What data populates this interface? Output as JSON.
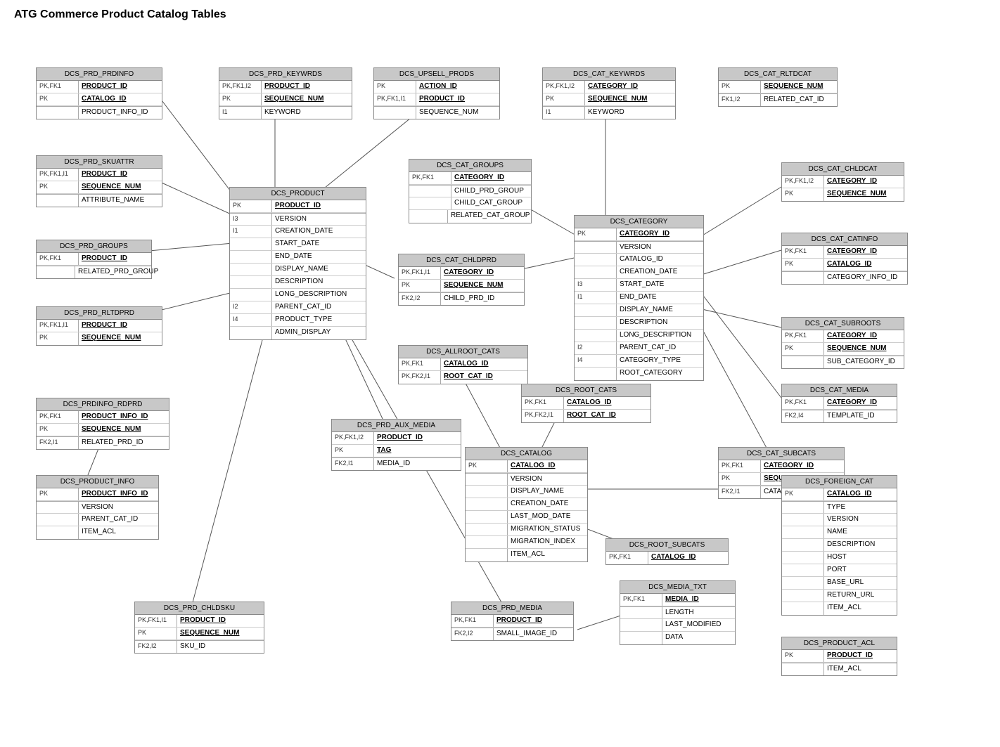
{
  "title": "ATG Commerce Product Catalog Tables",
  "tables": {
    "dcs_prd_prdinfo": {
      "name": "DCS_PRD_PRDINFO",
      "rows": [
        {
          "key": "PK,FK1",
          "field": "PRODUCT_ID",
          "pk": true
        },
        {
          "key": "PK",
          "field": "CATALOG_ID",
          "pk": true
        },
        {
          "key": "",
          "field": "PRODUCT_INFO_ID",
          "pk": false
        }
      ]
    },
    "dcs_prd_keywrds": {
      "name": "DCS_PRD_KEYWRDS",
      "rows": [
        {
          "key": "PK,FK1,I2",
          "field": "PRODUCT_ID",
          "pk": true
        },
        {
          "key": "PK",
          "field": "SEQUENCE_NUM",
          "pk": true
        },
        {
          "key": "I1",
          "field": "KEYWORD",
          "pk": false
        }
      ]
    },
    "dcs_upsell_prods": {
      "name": "DCS_UPSELL_PRODS",
      "rows": [
        {
          "key": "PK",
          "field": "ACTION_ID",
          "pk": true
        },
        {
          "key": "PK,FK1,I1",
          "field": "PRODUCT_ID",
          "pk": true
        },
        {
          "key": "",
          "field": "SEQUENCE_NUM",
          "pk": false
        }
      ]
    },
    "dcs_cat_keywrds": {
      "name": "DCS_CAT_KEYWRDS",
      "rows": [
        {
          "key": "PK,FK1,I2",
          "field": "CATEGORY_ID",
          "pk": true
        },
        {
          "key": "PK",
          "field": "SEQUENCE_NUM",
          "pk": true
        },
        {
          "key": "I1",
          "field": "KEYWORD",
          "pk": false
        }
      ]
    },
    "dcs_cat_rltdcat": {
      "name": "DCS_CAT_RLTDCAT",
      "rows": [
        {
          "key": "PK",
          "field": "SEQUENCE_NUM",
          "pk": true
        },
        {
          "key": "FK1,I2",
          "field": "RELATED_CAT_ID",
          "pk": false
        }
      ]
    },
    "dcs_prd_skuattr": {
      "name": "DCS_PRD_SKUATTR",
      "rows": [
        {
          "key": "PK,FK1,I1",
          "field": "PRODUCT_ID",
          "pk": true
        },
        {
          "key": "PK",
          "field": "SEQUENCE_NUM",
          "pk": true
        },
        {
          "key": "",
          "field": "ATTRIBUTE_NAME",
          "pk": false
        }
      ]
    },
    "dcs_product": {
      "name": "DCS_PRODUCT",
      "rows": [
        {
          "key": "PK",
          "field": "PRODUCT_ID",
          "pk": true
        },
        {
          "key": "I3",
          "field": "VERSION",
          "pk": false
        },
        {
          "key": "I1",
          "field": "CREATION_DATE",
          "pk": false
        },
        {
          "key": "",
          "field": "START_DATE",
          "pk": false
        },
        {
          "key": "",
          "field": "END_DATE",
          "pk": false
        },
        {
          "key": "",
          "field": "DISPLAY_NAME",
          "pk": false
        },
        {
          "key": "",
          "field": "DESCRIPTION",
          "pk": false
        },
        {
          "key": "",
          "field": "LONG_DESCRIPTION",
          "pk": false
        },
        {
          "key": "I2",
          "field": "PARENT_CAT_ID",
          "pk": false
        },
        {
          "key": "I4",
          "field": "PRODUCT_TYPE",
          "pk": false
        },
        {
          "key": "",
          "field": "ADMIN_DISPLAY",
          "pk": false
        }
      ]
    },
    "dcs_cat_groups": {
      "name": "DCS_CAT_GROUPS",
      "rows": [
        {
          "key": "PK,FK1",
          "field": "CATEGORY_ID",
          "pk": true
        },
        {
          "key": "",
          "field": "CHILD_PRD_GROUP",
          "pk": false
        },
        {
          "key": "",
          "field": "CHILD_CAT_GROUP",
          "pk": false
        },
        {
          "key": "",
          "field": "RELATED_CAT_GROUP",
          "pk": false
        }
      ]
    },
    "dcs_prd_groups": {
      "name": "DCS_PRD_GROUPS",
      "rows": [
        {
          "key": "PK,FK1",
          "field": "PRODUCT_ID",
          "pk": true
        },
        {
          "key": "",
          "field": "RELATED_PRD_GROUP",
          "pk": false
        }
      ]
    },
    "dcs_prd_rltdprd": {
      "name": "DCS_PRD_RLTDPRD",
      "rows": [
        {
          "key": "PK,FK1,I1",
          "field": "PRODUCT_ID",
          "pk": true
        },
        {
          "key": "PK",
          "field": "SEQUENCE_NUM",
          "pk": true
        }
      ]
    },
    "dcs_category": {
      "name": "DCS_CATEGORY",
      "rows": [
        {
          "key": "PK",
          "field": "CATEGORY_ID",
          "pk": true
        },
        {
          "key": "",
          "field": "VERSION",
          "pk": false
        },
        {
          "key": "",
          "field": "CATALOG_ID",
          "pk": false
        },
        {
          "key": "",
          "field": "CREATION_DATE",
          "pk": false
        },
        {
          "key": "I3",
          "field": "START_DATE",
          "pk": false
        },
        {
          "key": "I1",
          "field": "END_DATE",
          "pk": false
        },
        {
          "key": "",
          "field": "DISPLAY_NAME",
          "pk": false
        },
        {
          "key": "",
          "field": "DESCRIPTION",
          "pk": false
        },
        {
          "key": "",
          "field": "LONG_DESCRIPTION",
          "pk": false
        },
        {
          "key": "I2",
          "field": "PARENT_CAT_ID",
          "pk": false
        },
        {
          "key": "I4",
          "field": "CATEGORY_TYPE",
          "pk": false
        },
        {
          "key": "",
          "field": "ROOT_CATEGORY",
          "pk": false
        }
      ]
    },
    "dcs_cat_chldprd": {
      "name": "DCS_CAT_CHLDPRD",
      "rows": [
        {
          "key": "PK,FK1,I1",
          "field": "CATEGORY_ID",
          "pk": true
        },
        {
          "key": "PK",
          "field": "SEQUENCE_NUM",
          "pk": true
        },
        {
          "key": "FK2,I2",
          "field": "CHILD_PRD_ID",
          "pk": false
        }
      ]
    },
    "dcs_cat_chldcat": {
      "name": "DCS_CAT_CHLDCAT",
      "rows": [
        {
          "key": "PK,FK1,I2",
          "field": "CATEGORY_ID",
          "pk": true
        },
        {
          "key": "PK",
          "field": "SEQUENCE_NUM",
          "pk": true
        }
      ]
    },
    "dcs_cat_catinfo": {
      "name": "DCS_CAT_CATINFO",
      "rows": [
        {
          "key": "PK,FK1",
          "field": "CATEGORY_ID",
          "pk": true
        },
        {
          "key": "PK",
          "field": "CATALOG_ID",
          "pk": true
        },
        {
          "key": "",
          "field": "CATEGORY_INFO_ID",
          "pk": false
        }
      ]
    },
    "dcs_allroot_cats": {
      "name": "DCS_ALLROOT_CATS",
      "rows": [
        {
          "key": "PK,FK1",
          "field": "CATALOG_ID",
          "pk": true
        },
        {
          "key": "PK,FK2,I1",
          "field": "ROOT_CAT_ID",
          "pk": true
        }
      ]
    },
    "dcs_cat_subroots": {
      "name": "DCS_CAT_SUBROOTS",
      "rows": [
        {
          "key": "PK,FK1",
          "field": "CATEGORY_ID",
          "pk": true
        },
        {
          "key": "PK",
          "field": "SEQUENCE_NUM",
          "pk": true
        },
        {
          "key": "",
          "field": "SUB_CATEGORY_ID",
          "pk": false
        }
      ]
    },
    "dcs_root_cats": {
      "name": "DCS_ROOT_CATS",
      "rows": [
        {
          "key": "PK,FK1",
          "field": "CATALOG_ID",
          "pk": true
        },
        {
          "key": "PK,FK2,I1",
          "field": "ROOT_CAT_ID",
          "pk": true
        }
      ]
    },
    "dcs_prdinfo_rdprd": {
      "name": "DCS_PRDINFO_RDPRD",
      "rows": [
        {
          "key": "PK,FK1",
          "field": "PRODUCT_INFO_ID",
          "pk": true
        },
        {
          "key": "PK",
          "field": "SEQUENCE_NUM",
          "pk": true
        },
        {
          "key": "FK2,I1",
          "field": "RELATED_PRD_ID",
          "pk": false
        }
      ]
    },
    "dcs_product_info": {
      "name": "DCS_PRODUCT_INFO",
      "rows": [
        {
          "key": "PK",
          "field": "PRODUCT_INFO_ID",
          "pk": true
        },
        {
          "key": "",
          "field": "VERSION",
          "pk": false
        },
        {
          "key": "",
          "field": "PARENT_CAT_ID",
          "pk": false
        },
        {
          "key": "",
          "field": "ITEM_ACL",
          "pk": false
        }
      ]
    },
    "dcs_prd_aux_media": {
      "name": "DCS_PRD_AUX_MEDIA",
      "rows": [
        {
          "key": "PK,FK1,I2",
          "field": "PRODUCT_ID",
          "pk": true
        },
        {
          "key": "PK",
          "field": "TAG",
          "pk": true
        },
        {
          "key": "FK2,I1",
          "field": "MEDIA_ID",
          "pk": false
        }
      ]
    },
    "dcs_catalog": {
      "name": "DCS_CATALOG",
      "rows": [
        {
          "key": "PK",
          "field": "CATALOG_ID",
          "pk": true
        },
        {
          "key": "",
          "field": "VERSION",
          "pk": false
        },
        {
          "key": "",
          "field": "DISPLAY_NAME",
          "pk": false
        },
        {
          "key": "",
          "field": "CREATION_DATE",
          "pk": false
        },
        {
          "key": "",
          "field": "LAST_MOD_DATE",
          "pk": false
        },
        {
          "key": "",
          "field": "MIGRATION_STATUS",
          "pk": false
        },
        {
          "key": "",
          "field": "MIGRATION_INDEX",
          "pk": false
        },
        {
          "key": "",
          "field": "ITEM_ACL",
          "pk": false
        }
      ]
    },
    "dcs_cat_media": {
      "name": "DCS_CAT_MEDIA",
      "rows": [
        {
          "key": "PK,FK1",
          "field": "CATEGORY_ID",
          "pk": true
        },
        {
          "key": "FK2,I4",
          "field": "TEMPLATE_ID",
          "pk": false
        }
      ]
    },
    "dcs_cat_subcats": {
      "name": "DCS_CAT_SUBCATS",
      "rows": [
        {
          "key": "PK,FK1",
          "field": "CATEGORY_ID",
          "pk": true
        },
        {
          "key": "PK",
          "field": "SEQUENCE_NUM",
          "pk": true
        },
        {
          "key": "FK2,I1",
          "field": "CATALOG_ID",
          "pk": false
        }
      ]
    },
    "dcs_root_subcats": {
      "name": "DCS_ROOT_SUBCATS",
      "rows": [
        {
          "key": "PK,FK1",
          "field": "CATALOG_ID",
          "pk": true
        }
      ]
    },
    "dcs_prd_chldsku": {
      "name": "DCS_PRD_CHLDSKU",
      "rows": [
        {
          "key": "PK,FK1,I1",
          "field": "PRODUCT_ID",
          "pk": true
        },
        {
          "key": "PK",
          "field": "SEQUENCE_NUM",
          "pk": true
        },
        {
          "key": "FK2,I2",
          "field": "SKU_ID",
          "pk": false
        }
      ]
    },
    "dcs_prd_media": {
      "name": "DCS_PRD_MEDIA",
      "rows": [
        {
          "key": "PK,FK1",
          "field": "PRODUCT_ID",
          "pk": true
        },
        {
          "key": "FK2,I2",
          "field": "SMALL_IMAGE_ID",
          "pk": false
        }
      ]
    },
    "dcs_media_txt": {
      "name": "DCS_MEDIA_TXT",
      "rows": [
        {
          "key": "PK,FK1",
          "field": "MEDIA_ID",
          "pk": true
        },
        {
          "key": "",
          "field": "LENGTH",
          "pk": false
        },
        {
          "key": "",
          "field": "LAST_MODIFIED",
          "pk": false
        },
        {
          "key": "",
          "field": "DATA",
          "pk": false
        }
      ]
    },
    "dcs_foreign_cat": {
      "name": "DCS_FOREIGN_CAT",
      "rows": [
        {
          "key": "PK",
          "field": "CATALOG_ID",
          "pk": true
        },
        {
          "key": "",
          "field": "TYPE",
          "pk": false
        },
        {
          "key": "",
          "field": "VERSION",
          "pk": false
        },
        {
          "key": "",
          "field": "NAME",
          "pk": false
        },
        {
          "key": "",
          "field": "DESCRIPTION",
          "pk": false
        },
        {
          "key": "",
          "field": "HOST",
          "pk": false
        },
        {
          "key": "",
          "field": "PORT",
          "pk": false
        },
        {
          "key": "",
          "field": "BASE_URL",
          "pk": false
        },
        {
          "key": "",
          "field": "RETURN_URL",
          "pk": false
        },
        {
          "key": "",
          "field": "ITEM_ACL",
          "pk": false
        }
      ]
    },
    "dcs_product_acl": {
      "name": "DCS_PRODUCT_ACL",
      "rows": [
        {
          "key": "PK",
          "field": "PRODUCT_ID",
          "pk": true
        },
        {
          "key": "",
          "field": "ITEM_ACL",
          "pk": false
        }
      ]
    }
  }
}
